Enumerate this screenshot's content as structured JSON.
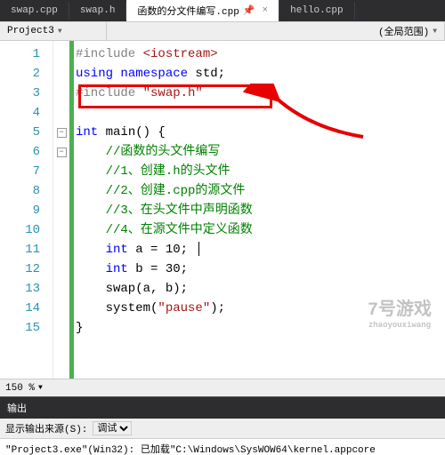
{
  "tabs": {
    "t1": "swap.cpp",
    "t2": "swap.h",
    "t3": "函数的分文件编写.cpp",
    "t4": "hello.cpp"
  },
  "toolbar": {
    "project": "Project3",
    "scope": "(全局范围)"
  },
  "code": {
    "l1a": "#include ",
    "l1b": "<iostream>",
    "l2a": "using",
    "l2b": " namespace",
    "l2c": " std;",
    "l3a": "#include ",
    "l3b": "\"swap.h\"",
    "l5a": "int",
    "l5b": " main() {",
    "l6": "    //函数的头文件编写",
    "l7": "    //1、创建.h的头文件",
    "l8": "    //2、创建.cpp的源文件",
    "l9": "    //3、在头文件中声明函数",
    "l10": "    //4、在源文件中定义函数",
    "l11a": "    int",
    "l11b": " a = 10;",
    "l12a": "    int",
    "l12b": " b = 30;",
    "l13": "    swap(a, b);",
    "l14a": "    system(",
    "l14b": "\"pause\"",
    "l14c": ");",
    "l15": "}"
  },
  "lines": [
    "1",
    "2",
    "3",
    "4",
    "5",
    "6",
    "7",
    "8",
    "9",
    "10",
    "11",
    "12",
    "13",
    "14",
    "15"
  ],
  "zoom": "150 %",
  "output": {
    "title": "输出",
    "label": "显示输出来源(S):",
    "source": "调试",
    "text": "\"Project3.exe\"(Win32): 已加载\"C:\\Windows\\SysWOW64\\kernel.appcore"
  },
  "watermark": {
    "main": "7号游戏",
    "sub": "zhaoyouxiwang"
  }
}
